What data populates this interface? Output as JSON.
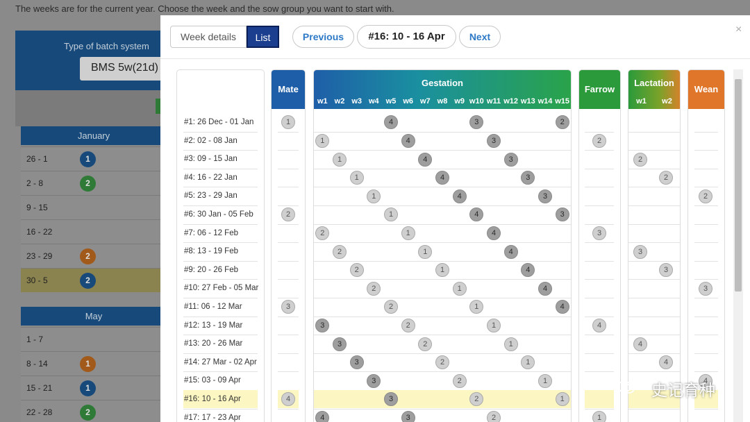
{
  "background": {
    "intro": "The weeks are for the current year. Choose the week and the sow group you want to start with.",
    "batch_label": "Type of batch system",
    "batch_value": "BMS 5w(21d)",
    "months": [
      {
        "name": "January",
        "rows": [
          {
            "label": "26 - 1",
            "group": "1",
            "color": "#174a7a"
          },
          {
            "label": "2 - 8",
            "group": "2",
            "color": "#2f7a37"
          },
          {
            "label": "9 - 15",
            "group": "",
            "color": ""
          },
          {
            "label": "16 - 22",
            "group": "",
            "color": ""
          },
          {
            "label": "23 - 29",
            "group": "2",
            "color": "#a25a1a"
          },
          {
            "label": "30 - 5",
            "group": "2",
            "color": "#174a7a",
            "highlight": true
          }
        ]
      },
      {
        "name": "May",
        "rows": [
          {
            "label": "1 - 7",
            "group": "",
            "color": ""
          },
          {
            "label": "8 - 14",
            "group": "1",
            "color": "#a25a1a"
          },
          {
            "label": "15 - 21",
            "group": "1",
            "color": "#174a7a"
          },
          {
            "label": "22 - 28",
            "group": "2",
            "color": "#2f7a37"
          }
        ]
      }
    ]
  },
  "modal": {
    "tabs": [
      "Week details",
      "List"
    ],
    "previous_label": "Previous",
    "week_title": "#16: 10 - 16 Apr",
    "next_label": "Next",
    "close_glyph": "×",
    "columns": {
      "mate": {
        "title": "Mate",
        "color": "#1e5ea8"
      },
      "gestation": {
        "title": "Gestation",
        "subs": [
          "w1",
          "w2",
          "w3",
          "w4",
          "w5",
          "w6",
          "w7",
          "w8",
          "w9",
          "w10",
          "w11",
          "w12",
          "w13",
          "w14",
          "w15"
        ]
      },
      "farrow": {
        "title": "Farrow",
        "color": "#2a9a3a"
      },
      "lactation": {
        "title": "Lactation",
        "subs": [
          "w1",
          "w2"
        ]
      },
      "wean": {
        "title": "Wean",
        "color": "#e0762a"
      }
    },
    "highlight_week": 15,
    "weeks": [
      {
        "label": "#1: 26 Dec - 01 Jan",
        "mate": "1",
        "gest": [
          null,
          null,
          null,
          null,
          "4",
          null,
          null,
          null,
          null,
          "3",
          null,
          null,
          null,
          null,
          "2"
        ],
        "farrow": "",
        "lact": [
          null,
          null
        ],
        "wean": ""
      },
      {
        "label": "#2: 02 - 08 Jan",
        "mate": "",
        "gest": [
          "1",
          null,
          null,
          null,
          null,
          "4",
          null,
          null,
          null,
          null,
          "3",
          null,
          null,
          null,
          null
        ],
        "farrow": "2",
        "lact": [
          null,
          null
        ],
        "wean": ""
      },
      {
        "label": "#3: 09 - 15 Jan",
        "mate": "",
        "gest": [
          null,
          "1",
          null,
          null,
          null,
          null,
          "4",
          null,
          null,
          null,
          null,
          "3",
          null,
          null,
          null
        ],
        "farrow": "",
        "lact": [
          "2",
          null
        ],
        "wean": ""
      },
      {
        "label": "#4: 16 - 22 Jan",
        "mate": "",
        "gest": [
          null,
          null,
          "1",
          null,
          null,
          null,
          null,
          "4",
          null,
          null,
          null,
          null,
          "3",
          null,
          null
        ],
        "farrow": "",
        "lact": [
          null,
          "2"
        ],
        "wean": ""
      },
      {
        "label": "#5: 23 - 29 Jan",
        "mate": "",
        "gest": [
          null,
          null,
          null,
          "1",
          null,
          null,
          null,
          null,
          "4",
          null,
          null,
          null,
          null,
          "3",
          null
        ],
        "farrow": "",
        "lact": [
          null,
          null
        ],
        "wean": "2"
      },
      {
        "label": "#6: 30 Jan - 05 Feb",
        "mate": "2",
        "gest": [
          null,
          null,
          null,
          null,
          "1",
          null,
          null,
          null,
          null,
          "4",
          null,
          null,
          null,
          null,
          "3"
        ],
        "farrow": "",
        "lact": [
          null,
          null
        ],
        "wean": ""
      },
      {
        "label": "#7: 06 - 12 Feb",
        "mate": "",
        "gest": [
          "2",
          null,
          null,
          null,
          null,
          "1",
          null,
          null,
          null,
          null,
          "4",
          null,
          null,
          null,
          null
        ],
        "farrow": "3",
        "lact": [
          null,
          null
        ],
        "wean": ""
      },
      {
        "label": "#8: 13 - 19 Feb",
        "mate": "",
        "gest": [
          null,
          "2",
          null,
          null,
          null,
          null,
          "1",
          null,
          null,
          null,
          null,
          "4",
          null,
          null,
          null
        ],
        "farrow": "",
        "lact": [
          "3",
          null
        ],
        "wean": ""
      },
      {
        "label": "#9: 20 - 26 Feb",
        "mate": "",
        "gest": [
          null,
          null,
          "2",
          null,
          null,
          null,
          null,
          "1",
          null,
          null,
          null,
          null,
          "4",
          null,
          null
        ],
        "farrow": "",
        "lact": [
          null,
          "3"
        ],
        "wean": ""
      },
      {
        "label": "#10: 27 Feb - 05 Mar",
        "mate": "",
        "gest": [
          null,
          null,
          null,
          "2",
          null,
          null,
          null,
          null,
          "1",
          null,
          null,
          null,
          null,
          "4",
          null
        ],
        "farrow": "",
        "lact": [
          null,
          null
        ],
        "wean": "3"
      },
      {
        "label": "#11: 06 - 12 Mar",
        "mate": "3",
        "gest": [
          null,
          null,
          null,
          null,
          "2",
          null,
          null,
          null,
          null,
          "1",
          null,
          null,
          null,
          null,
          "4"
        ],
        "farrow": "",
        "lact": [
          null,
          null
        ],
        "wean": ""
      },
      {
        "label": "#12: 13 - 19 Mar",
        "mate": "",
        "gest": [
          "3",
          null,
          null,
          null,
          null,
          "2",
          null,
          null,
          null,
          null,
          "1",
          null,
          null,
          null,
          null
        ],
        "farrow": "4",
        "lact": [
          null,
          null
        ],
        "wean": ""
      },
      {
        "label": "#13: 20 - 26 Mar",
        "mate": "",
        "gest": [
          null,
          "3",
          null,
          null,
          null,
          null,
          "2",
          null,
          null,
          null,
          null,
          "1",
          null,
          null,
          null
        ],
        "farrow": "",
        "lact": [
          "4",
          null
        ],
        "wean": ""
      },
      {
        "label": "#14: 27 Mar - 02 Apr",
        "mate": "",
        "gest": [
          null,
          null,
          "3",
          null,
          null,
          null,
          null,
          "2",
          null,
          null,
          null,
          null,
          "1",
          null,
          null
        ],
        "farrow": "",
        "lact": [
          null,
          "4"
        ],
        "wean": ""
      },
      {
        "label": "#15: 03 - 09 Apr",
        "mate": "",
        "gest": [
          null,
          null,
          null,
          "3",
          null,
          null,
          null,
          null,
          "2",
          null,
          null,
          null,
          null,
          "1",
          null
        ],
        "farrow": "",
        "lact": [
          null,
          null
        ],
        "wean": "4"
      },
      {
        "label": "#16: 10 - 16 Apr",
        "mate": "4",
        "gest": [
          null,
          null,
          null,
          null,
          "3",
          null,
          null,
          null,
          null,
          "2",
          null,
          null,
          null,
          null,
          "1"
        ],
        "farrow": "",
        "lact": [
          null,
          null
        ],
        "wean": ""
      },
      {
        "label": "#17: 17 - 23 Apr",
        "mate": "",
        "gest": [
          "4",
          null,
          null,
          null,
          null,
          "3",
          null,
          null,
          null,
          null,
          "2",
          null,
          null,
          null,
          null
        ],
        "farrow": "1",
        "lact": [
          null,
          null
        ],
        "wean": ""
      }
    ]
  },
  "watermark": {
    "text": "史记育种"
  }
}
